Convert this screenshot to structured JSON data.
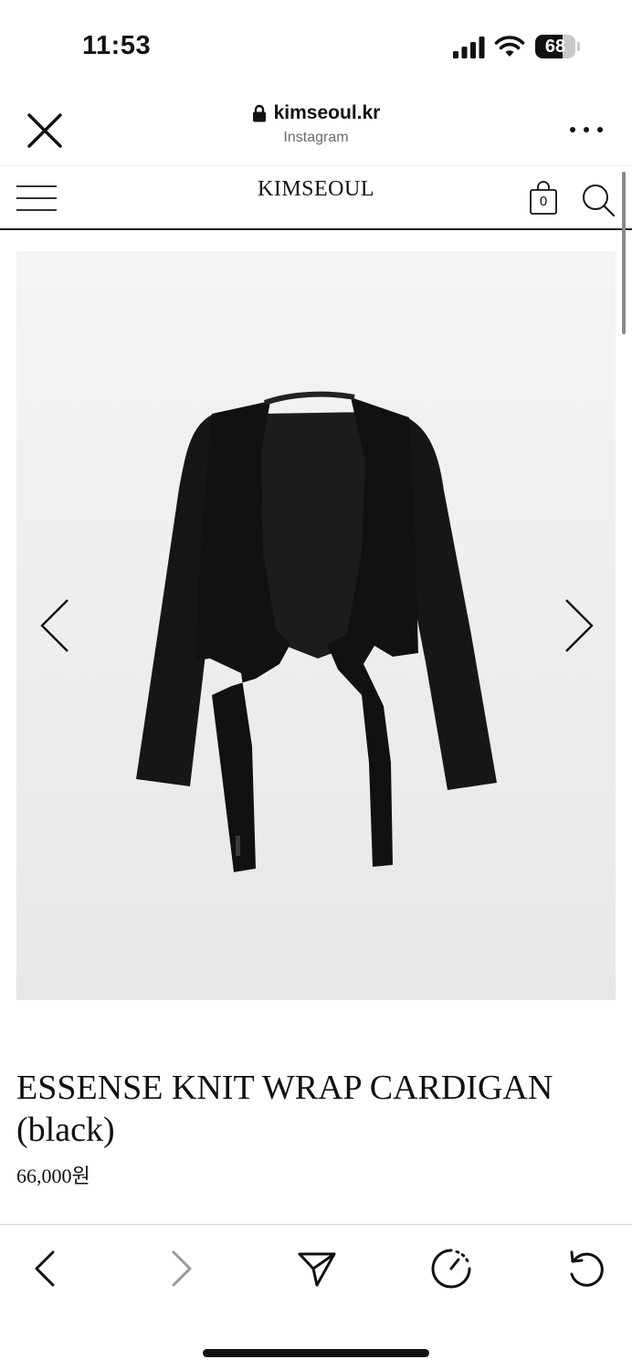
{
  "status_bar": {
    "time": "11:53",
    "battery_level": "68",
    "battery_fraction": 0.68
  },
  "browser": {
    "domain": "kimseoul.kr",
    "source": "Instagram"
  },
  "site": {
    "brand": "KIMSEOUL",
    "cart_count": "0"
  },
  "product": {
    "title": "ESSENSE KNIT WRAP CARDIGAN (black)",
    "price": "66,000원",
    "image_alt": "black knit wrap cardigan"
  },
  "icons": {
    "close": "close-icon",
    "lock": "lock-icon",
    "more": "more-icon",
    "menu": "menu-icon",
    "cart": "bag-icon",
    "search": "search-icon",
    "prev": "chevron-left-icon",
    "next": "chevron-right-icon",
    "back": "back-arrow-icon",
    "forward": "forward-arrow-icon",
    "share": "send-icon",
    "history": "timer-icon",
    "reload": "reload-icon"
  },
  "colors": {
    "background": "#ffffff",
    "text": "#111111",
    "image_bg": "#eeeeee",
    "garment": "#151515",
    "disabled": "#9a9a9a"
  }
}
